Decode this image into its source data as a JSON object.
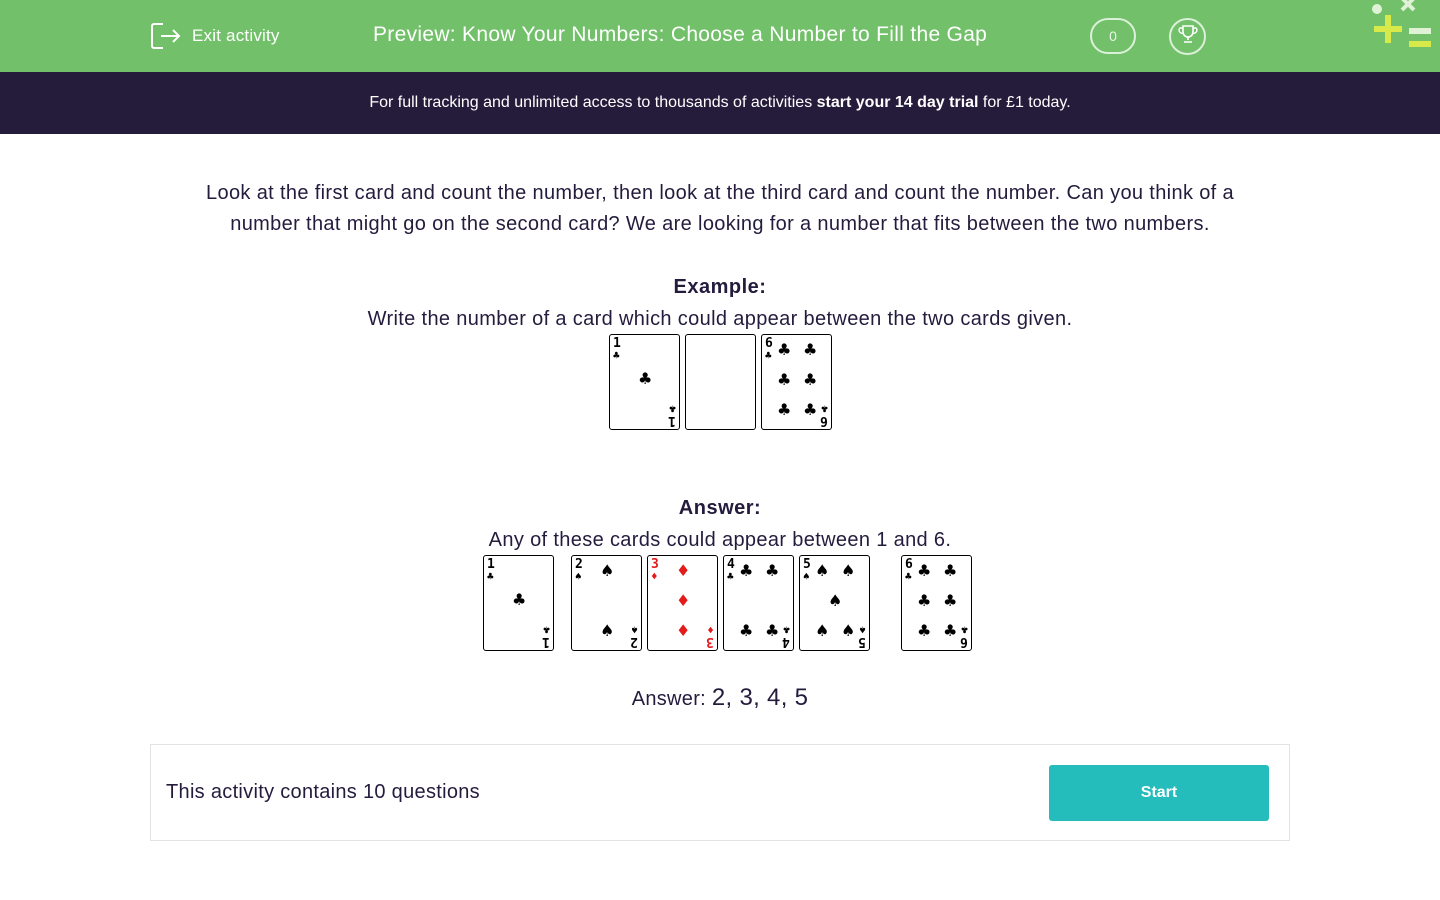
{
  "header": {
    "exit_label": "Exit activity",
    "title": "Preview: Know Your Numbers: Choose a Number to Fill the Gap",
    "score": "0",
    "brand_color": "#72c16a"
  },
  "promo": {
    "prefix": "For full tracking and unlimited access to thousands of activities ",
    "highlight": "start your 14 day trial",
    "suffix": " for £1 today."
  },
  "question": {
    "intro": "Look at the first card and count the number, then look at the third card and count the number. Can you think of a number that might go on the second card? We are looking for a number that fits between the two numbers.",
    "example_heading": "Example:",
    "example_prompt": "Write the number of a card which could appear between the two cards given.",
    "example_cards": [
      {
        "rank": "1",
        "suit": "clubs"
      },
      {
        "rank": "",
        "suit": "blank"
      },
      {
        "rank": "6",
        "suit": "clubs"
      }
    ],
    "answer_heading": "Answer:",
    "answer_prompt": "Any of these cards could appear between 1 and 6.",
    "answer_cards": [
      {
        "rank": "1",
        "suit": "clubs"
      },
      {
        "rank": "2",
        "suit": "spades"
      },
      {
        "rank": "3",
        "suit": "diamonds"
      },
      {
        "rank": "4",
        "suit": "clubs"
      },
      {
        "rank": "5",
        "suit": "spades"
      },
      {
        "rank": "6",
        "suit": "clubs"
      }
    ],
    "answer_label": "Answer: ",
    "answer_value": "2, 3, 4, 5"
  },
  "footer": {
    "question_count_text": "This activity contains 10 questions",
    "start_label": "Start",
    "start_color": "#25bcbc"
  }
}
